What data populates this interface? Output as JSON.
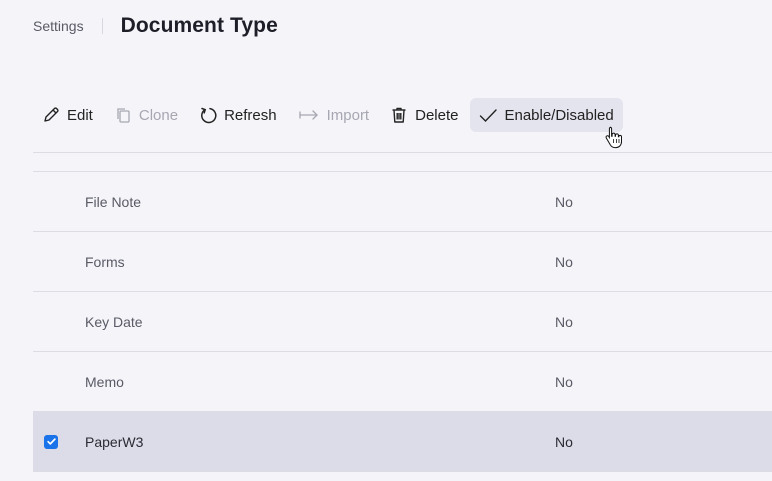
{
  "header": {
    "breadcrumb": "Settings",
    "title": "Document Type"
  },
  "toolbar": {
    "edit": "Edit",
    "clone": "Clone",
    "refresh": "Refresh",
    "import": "Import",
    "delete": "Delete",
    "enable_disabled": "Enable/Disabled"
  },
  "table": {
    "rows": [
      {
        "name": "File Note",
        "value": "No",
        "checked": false
      },
      {
        "name": "Forms",
        "value": "No",
        "checked": false
      },
      {
        "name": "Key Date",
        "value": "No",
        "checked": false
      },
      {
        "name": "Memo",
        "value": "No",
        "checked": false
      },
      {
        "name": "PaperW3",
        "value": "No",
        "checked": true
      }
    ]
  },
  "colors": {
    "accent": "#1a73e8",
    "selected_row": "#dcdce8",
    "hover_button": "#e4e4ee"
  },
  "icons": {
    "edit": "pencil-icon",
    "clone": "copy-icon",
    "refresh": "refresh-icon",
    "import": "import-arrow-icon",
    "delete": "trash-icon",
    "enable": "checkmark-icon",
    "cursor": "hand-pointer-cursor"
  }
}
